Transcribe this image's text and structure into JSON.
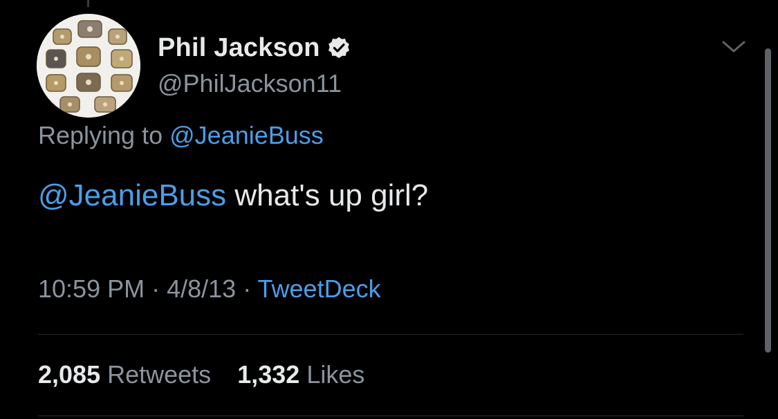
{
  "author": {
    "display_name": "Phil Jackson",
    "handle": "@PhilJackson11",
    "verified": true,
    "avatar_icon": "championship-rings-avatar"
  },
  "reply_context": {
    "prefix": "Replying to",
    "mention": "@JeanieBuss"
  },
  "tweet": {
    "mention": "@JeanieBuss",
    "text": " what's up girl?"
  },
  "meta": {
    "time": "10:59 PM",
    "separator": " · ",
    "date": "4/8/13",
    "source": "TweetDeck"
  },
  "stats": {
    "retweets_count": "2,085",
    "retweets_label": "Retweets",
    "likes_count": "1,332",
    "likes_label": "Likes"
  },
  "icons": {
    "verified": "verified-badge-icon",
    "menu": "chevron-down-icon"
  },
  "colors": {
    "background": "#000000",
    "primary_text": "#e7e9ea",
    "secondary_text": "#8b949e",
    "link": "#4a9eea"
  }
}
